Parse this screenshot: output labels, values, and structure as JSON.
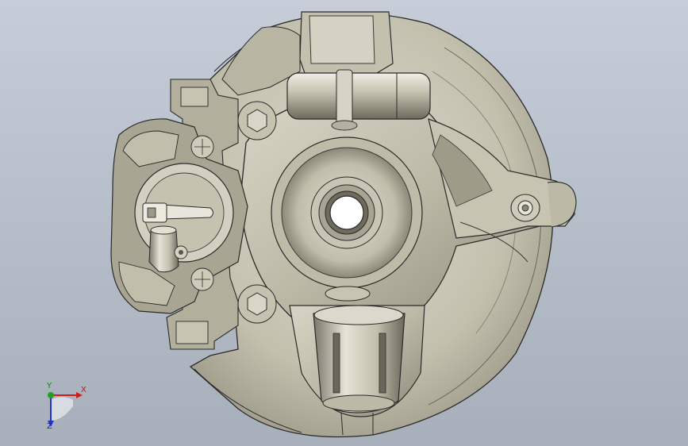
{
  "viewport": {
    "model_name": "",
    "background_top": "#c6cdd8",
    "background_bottom": "#a7afbb"
  },
  "triad": {
    "x_label": "X",
    "y_label": "Y",
    "z_label": "Z",
    "x_color": "#d21c1c",
    "y_color": "#1fa31f",
    "z_color": "#2233c8"
  },
  "model": {
    "body_color": "#c9c5b4",
    "shadow_color": "#6f6b5f",
    "edge_color": "#2a2a2a"
  }
}
